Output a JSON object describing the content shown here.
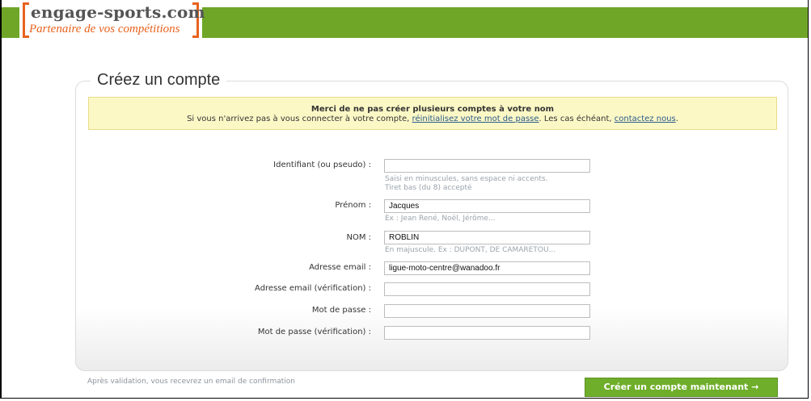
{
  "brand": {
    "title": "engage-sports.com",
    "subtitle": "Partenaire de vos compétitions"
  },
  "page": {
    "title": "Créez un compte"
  },
  "notice": {
    "headline": "Merci de ne pas créer plusieurs comptes à votre nom",
    "text_before": "Si vous n'arrivez pas à vous connecter à votre compte,",
    "reset_link": "réinitialisez votre mot de passe",
    "text_middle": ". Les cas échéant,",
    "contact_link": "contactez nous",
    "text_after": "."
  },
  "form": {
    "fields": [
      {
        "label": "Identifiant (ou pseudo) :",
        "value": "",
        "hint1": "Saisi en minuscules, sans espace ni accents.",
        "hint2": "Tiret bas (du 8) accepté"
      },
      {
        "label": "Prénom :",
        "value": "Jacques",
        "hint1": "Ex : Jean René, Noël, Jérôme..."
      },
      {
        "label": "NOM :",
        "value": "ROBLIN",
        "hint1": "En majuscule. Ex : DUPONT, DE CAMARETOU..."
      },
      {
        "label": "Adresse email :",
        "value": "ligue-moto-centre@wanadoo.fr"
      },
      {
        "label": "Adresse email (vérification) :",
        "value": ""
      },
      {
        "label": "Mot de passe :",
        "value": ""
      },
      {
        "label": "Mot de passe (vérification) :",
        "value": ""
      }
    ]
  },
  "footer": {
    "note": "Après validation, vous recevrez un email de confirmation",
    "submit_label": "Créer un compte maintenant →"
  },
  "colors": {
    "brand_green": "#6fa628",
    "brand_orange": "#e8621e",
    "notice_bg": "#fcf8c6",
    "button_green": "#6fae2a"
  }
}
